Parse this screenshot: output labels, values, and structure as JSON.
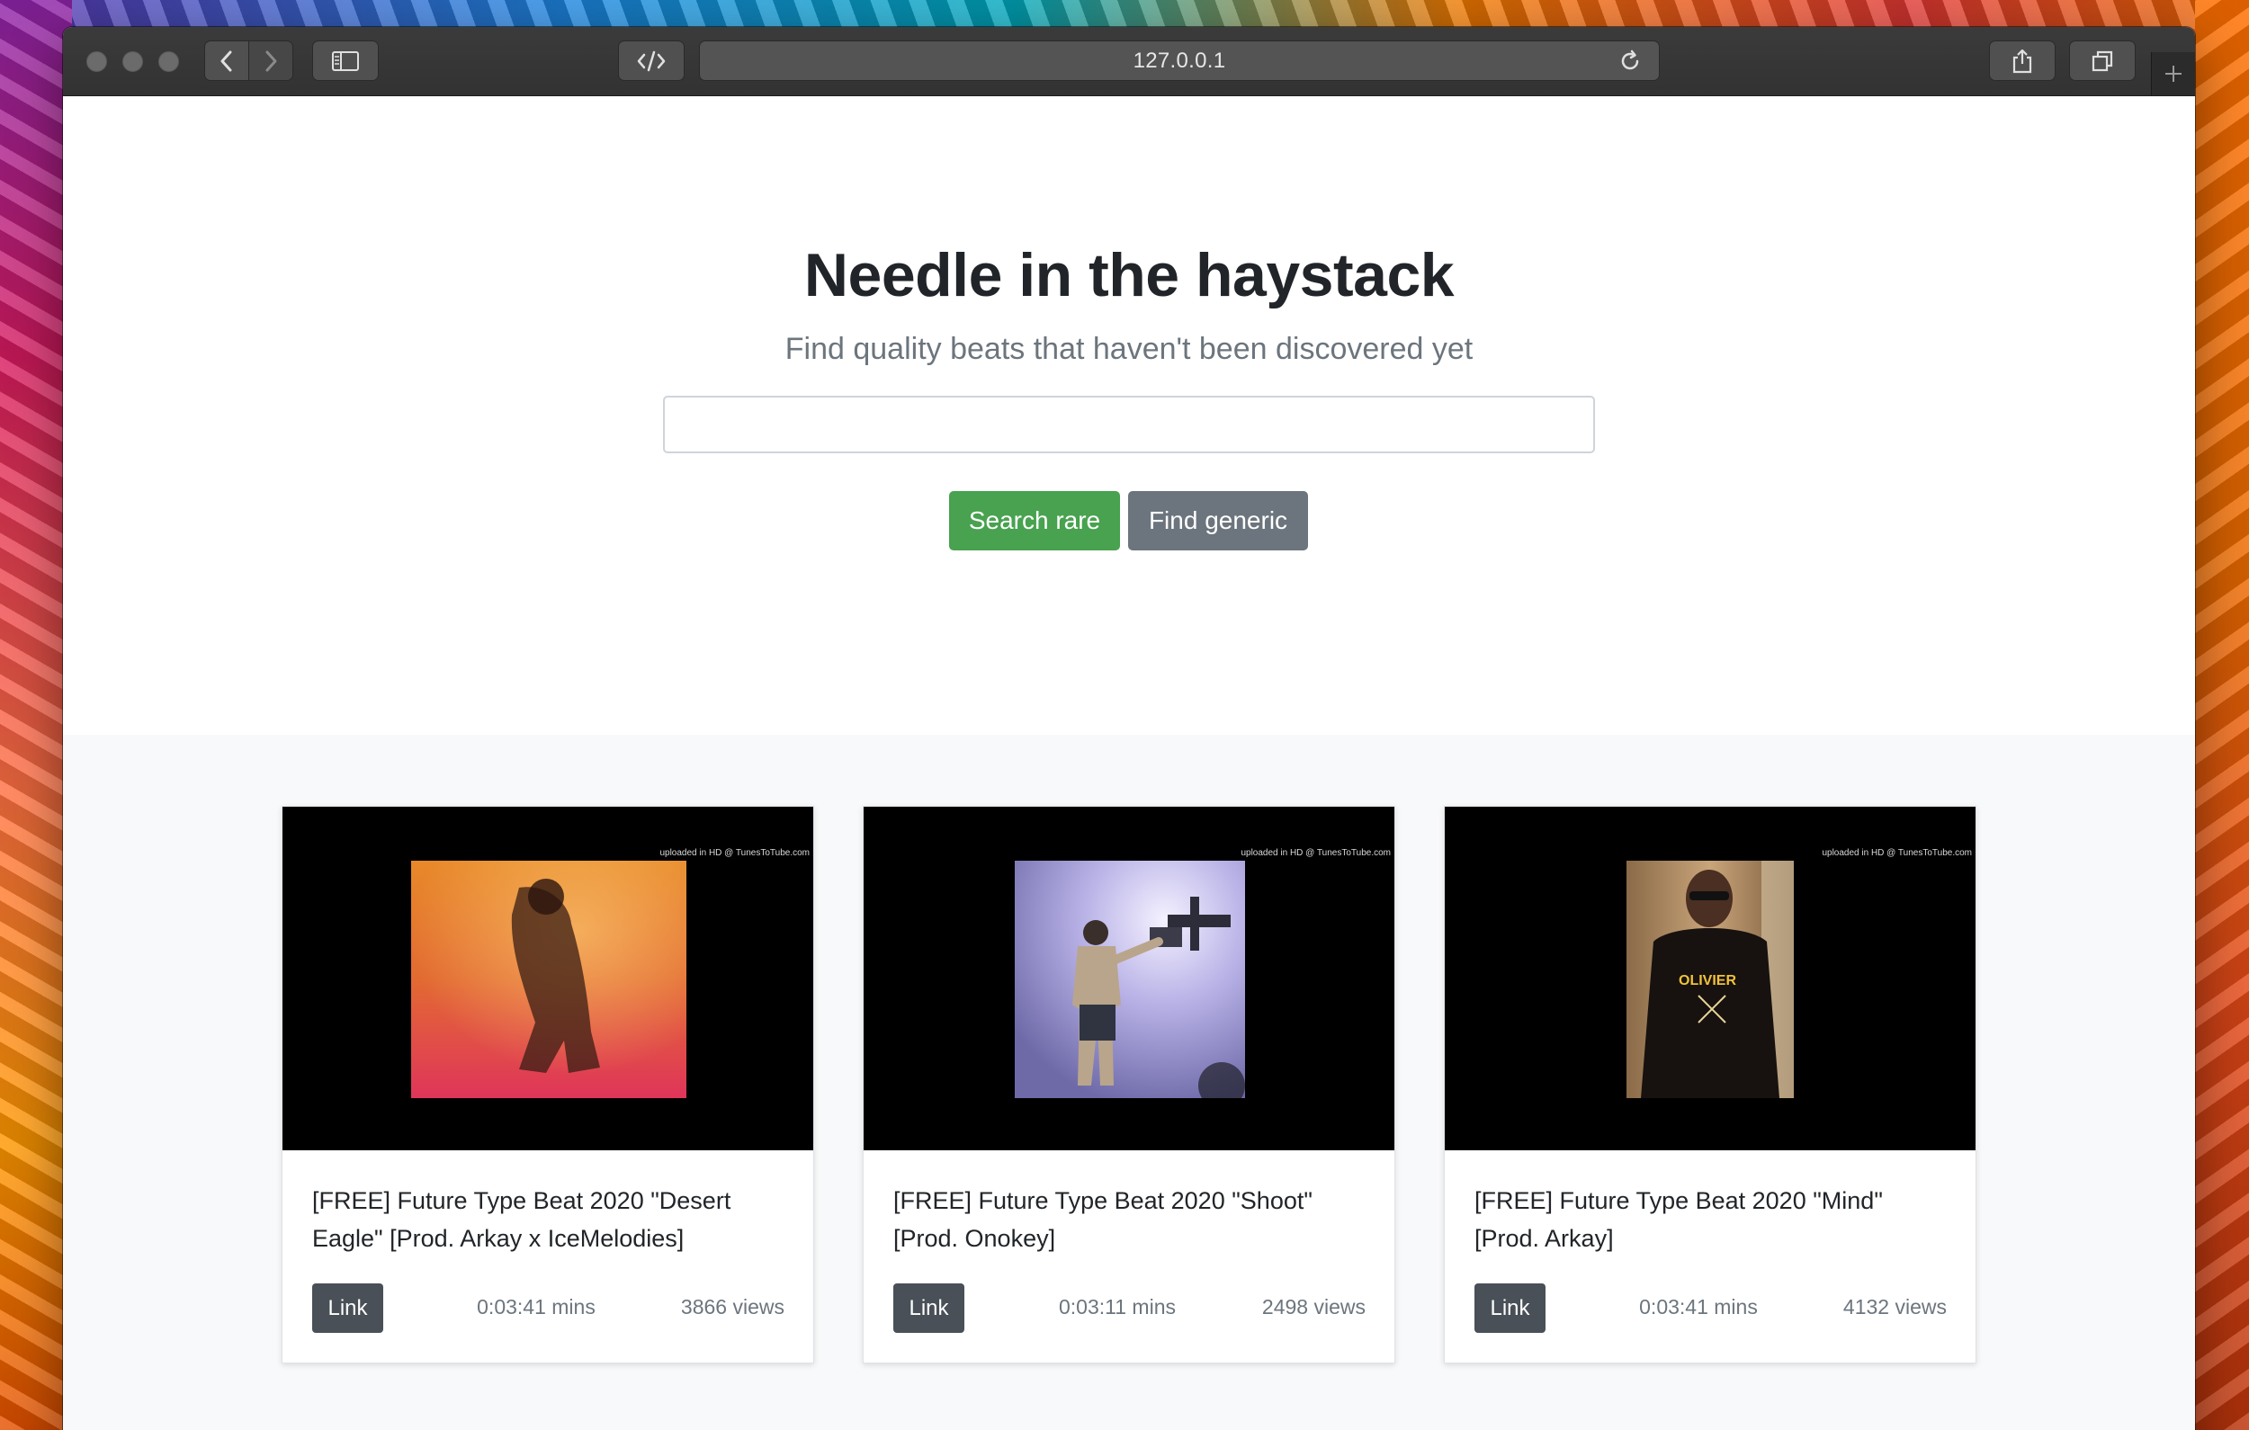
{
  "browser": {
    "address": "127.0.0.1"
  },
  "hero": {
    "title": "Needle in the haystack",
    "subtitle": "Find quality beats that haven't been discovered yet",
    "search_value": "",
    "search_rare_label": "Search rare",
    "find_generic_label": "Find generic"
  },
  "cards": [
    {
      "title": "[FREE] Future Type Beat 2020 \"Desert Eagle\" [Prod. Arkay x IceMelodies]",
      "link_label": "Link",
      "duration": "0:03:41 mins",
      "views": "3866 views",
      "watermark": "uploaded in HD @ TunesToTube.com"
    },
    {
      "title": "[FREE] Future Type Beat 2020 \"Shoot\" [Prod. Onokey]",
      "link_label": "Link",
      "duration": "0:03:11 mins",
      "views": "2498 views",
      "watermark": "uploaded in HD @ TunesToTube.com"
    },
    {
      "title": "[FREE] Future Type Beat 2020 \"Mind\" [Prod. Arkay]",
      "link_label": "Link",
      "duration": "0:03:41 mins",
      "views": "4132 views",
      "watermark": "uploaded in HD @ TunesToTube.com"
    }
  ],
  "colors": {
    "primary_green": "#48a24f",
    "secondary_gray": "#6c757d",
    "link_dark": "#495057"
  }
}
